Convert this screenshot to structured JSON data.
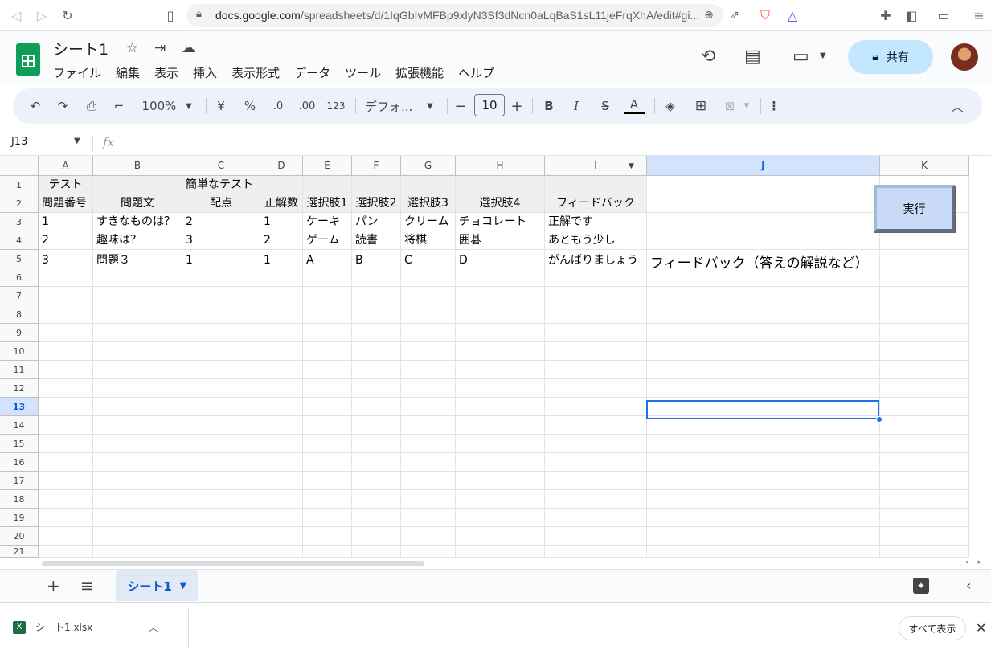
{
  "browser": {
    "url_host": "docs.google.com",
    "url_path": "/spreadsheets/d/1IqGbIvMFBp9xlyN3Sf3dNcn0aLqBaS1sL11jeFrqXhA/edit#gi..."
  },
  "app": {
    "title": "シート1",
    "menu": [
      "ファイル",
      "編集",
      "表示",
      "挿入",
      "表示形式",
      "データ",
      "ツール",
      "拡張機能",
      "ヘルプ"
    ],
    "share_label": "共有"
  },
  "toolbar": {
    "zoom": "100%",
    "currency": "¥",
    "percent": "%",
    "dec_decrease": ".0",
    "dec_increase": ".00",
    "number_format": "123",
    "font": "デフォ...",
    "font_size": "10"
  },
  "formula_bar": {
    "name_box": "J13",
    "fx": "fx"
  },
  "columns": [
    "A",
    "B",
    "C",
    "D",
    "E",
    "F",
    "G",
    "H",
    "I",
    "J",
    "K"
  ],
  "rows": [
    "1",
    "2",
    "3",
    "4",
    "5",
    "6",
    "7",
    "8",
    "9",
    "10",
    "11",
    "12",
    "13",
    "14",
    "15",
    "16",
    "17",
    "18",
    "19",
    "20",
    "21"
  ],
  "cells": {
    "A1": "テスト",
    "C1": "簡単なテスト",
    "A2": "問題番号",
    "B2": "問題文",
    "C2": "配点",
    "D2": "正解数",
    "E2": "選択肢1",
    "F2": "選択肢2",
    "G2": "選択肢3",
    "H2": "選択肢4",
    "I2": "フィードバック",
    "A3": "1",
    "B3": "すきなものは？",
    "C3": "2",
    "D3": "1",
    "E3": "ケーキ",
    "F3": "パン",
    "G3": "クリーム",
    "H3": "チョコレート",
    "I3": "正解です",
    "A4": "2",
    "B4": "趣味は？",
    "C4": "3",
    "D4": "2",
    "E4": "ゲーム",
    "F4": "読書",
    "G4": "将棋",
    "H4": "囲碁",
    "I4": "あともう少し",
    "A5": "3",
    "B5": "問題３",
    "C5": "1",
    "D5": "1",
    "E5": "A",
    "F5": "B",
    "G5": "C",
    "H5": "D",
    "I5": "がんばりましょう",
    "J5": "フィードバック（答えの解説など）"
  },
  "run_button_label": "実行",
  "sheet_tab": "シート1",
  "downloads": {
    "file_name": "シート1.xlsx",
    "show_all": "すべて表示"
  },
  "colors": {
    "accent": "#1a73e8",
    "share_bg": "#c2e7ff",
    "run_button_bg": "#c9daf8",
    "header_shade": "#efefef"
  }
}
